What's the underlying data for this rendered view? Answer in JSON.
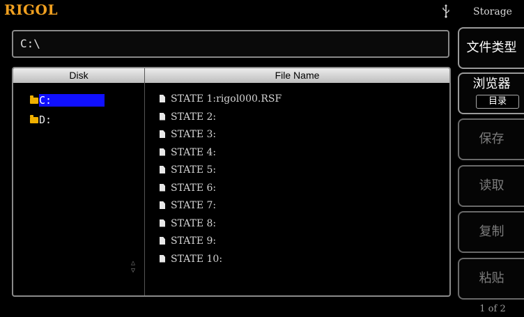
{
  "header": {
    "brand": "RIGOL",
    "menu_title": "Storage",
    "usb_icon": "usb-icon"
  },
  "path": "C:\\",
  "columns": {
    "disk": "Disk",
    "file": "File Name"
  },
  "disks": [
    {
      "label": "C:",
      "selected": true
    },
    {
      "label": "D:",
      "selected": false
    }
  ],
  "scroll_arrows": {
    "up": "△",
    "down": "▽"
  },
  "files": [
    "STATE 1:rigol000.RSF",
    "STATE 2:",
    "STATE 3:",
    "STATE 4:",
    "STATE 5:",
    "STATE 6:",
    "STATE 7:",
    "STATE 8:",
    "STATE 9:",
    "STATE 10:"
  ],
  "softkeys": {
    "file_type": "文件类型",
    "browser": "浏览器",
    "browser_sub": "目录",
    "save": "保存",
    "read": "读取",
    "copy": "复制",
    "paste": "粘贴"
  },
  "page_indicator": "1 of 2",
  "colors": {
    "brand": "#f0a020",
    "selection": "#1010ff",
    "folder": "#f0b000"
  }
}
